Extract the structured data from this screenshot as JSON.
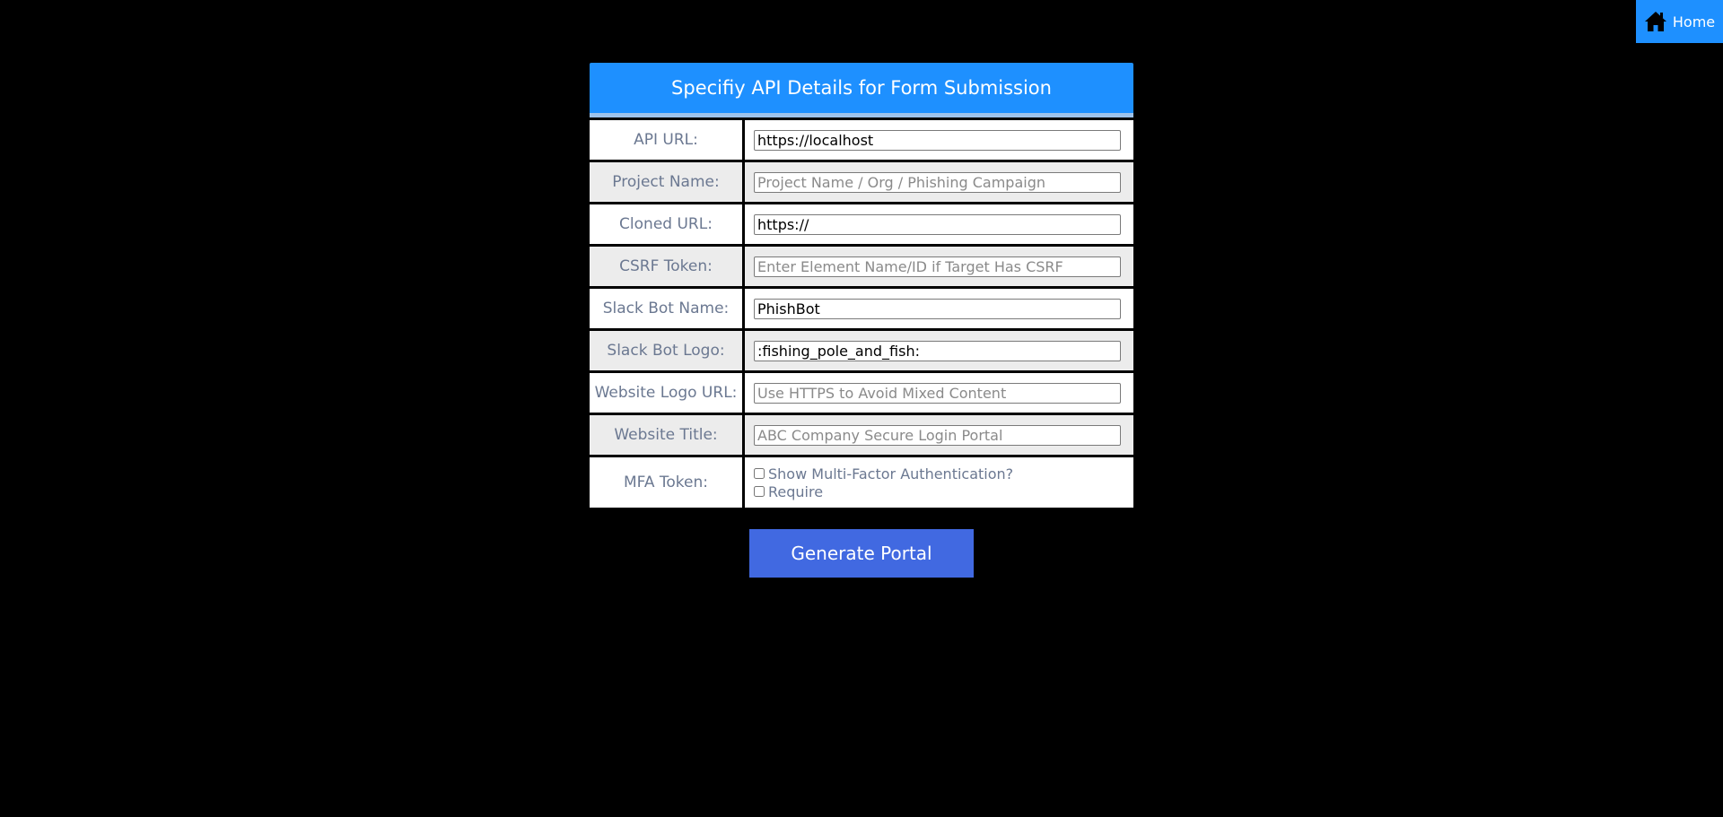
{
  "nav": {
    "home_label": "Home",
    "home_icon": "home-icon"
  },
  "form": {
    "title": "Specifiy API Details for Form Submission",
    "fields": [
      {
        "label": "API URL:",
        "value": "https://localhost",
        "placeholder": ""
      },
      {
        "label": "Project Name:",
        "value": "",
        "placeholder": "Project Name / Org / Phishing Campaign"
      },
      {
        "label": "Cloned URL:",
        "value": "https://",
        "placeholder": ""
      },
      {
        "label": "CSRF Token:",
        "value": "",
        "placeholder": "Enter Element Name/ID if Target Has CSRF"
      },
      {
        "label": "Slack Bot Name:",
        "value": "PhishBot",
        "placeholder": ""
      },
      {
        "label": "Slack Bot Logo:",
        "value": ":fishing_pole_and_fish:",
        "placeholder": ""
      },
      {
        "label": "Website Logo URL:",
        "value": "",
        "placeholder": "Use HTTPS to Avoid Mixed Content"
      },
      {
        "label": "Website Title:",
        "value": "",
        "placeholder": "ABC Company Secure Login Portal"
      }
    ],
    "mfa": {
      "label": "MFA Token:",
      "show_label": "Show Multi-Factor Authentication?",
      "show_checked": false,
      "require_label": "Require",
      "require_checked": false
    },
    "submit_label": "Generate Portal"
  },
  "colors": {
    "background": "#000000",
    "header": "#1e90ff",
    "button": "#4169e1",
    "label_text": "#6b7891"
  }
}
